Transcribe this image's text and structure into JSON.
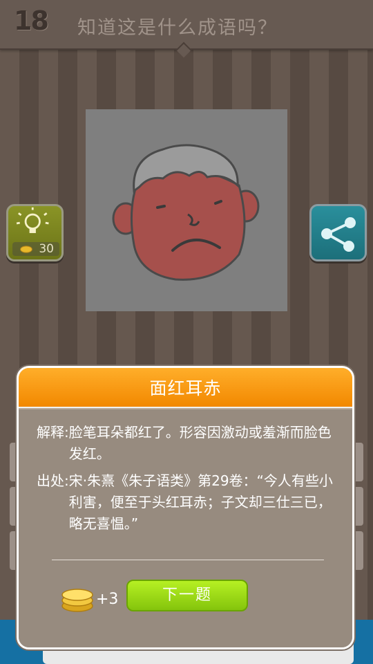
{
  "header": {
    "level": "18",
    "question": "知道这是什么成语吗？"
  },
  "hint": {
    "cost": "30"
  },
  "modal": {
    "title": "面红耳赤",
    "explain_label": "解释:",
    "explain_text": "脸笔耳朵都红了。形容因激动或羞渐而脸色发红。",
    "source_label": "出处:",
    "source_text": "宋·朱熹《朱子语类》第29卷：“今人有些小利害，便至于头红耳赤；子文却三仕三已，略无喜愠。”",
    "reward": "+3",
    "next_label": "下一题"
  },
  "colors": {
    "accent_orange": "#f28800",
    "next_green": "#96d816",
    "face_red": "#a6504c",
    "hint_olive": "#7a8420",
    "share_teal": "#23808c"
  },
  "icons": {
    "hint": "lightbulb-icon",
    "share": "share-icon",
    "coins": "gold-coins-icon"
  }
}
